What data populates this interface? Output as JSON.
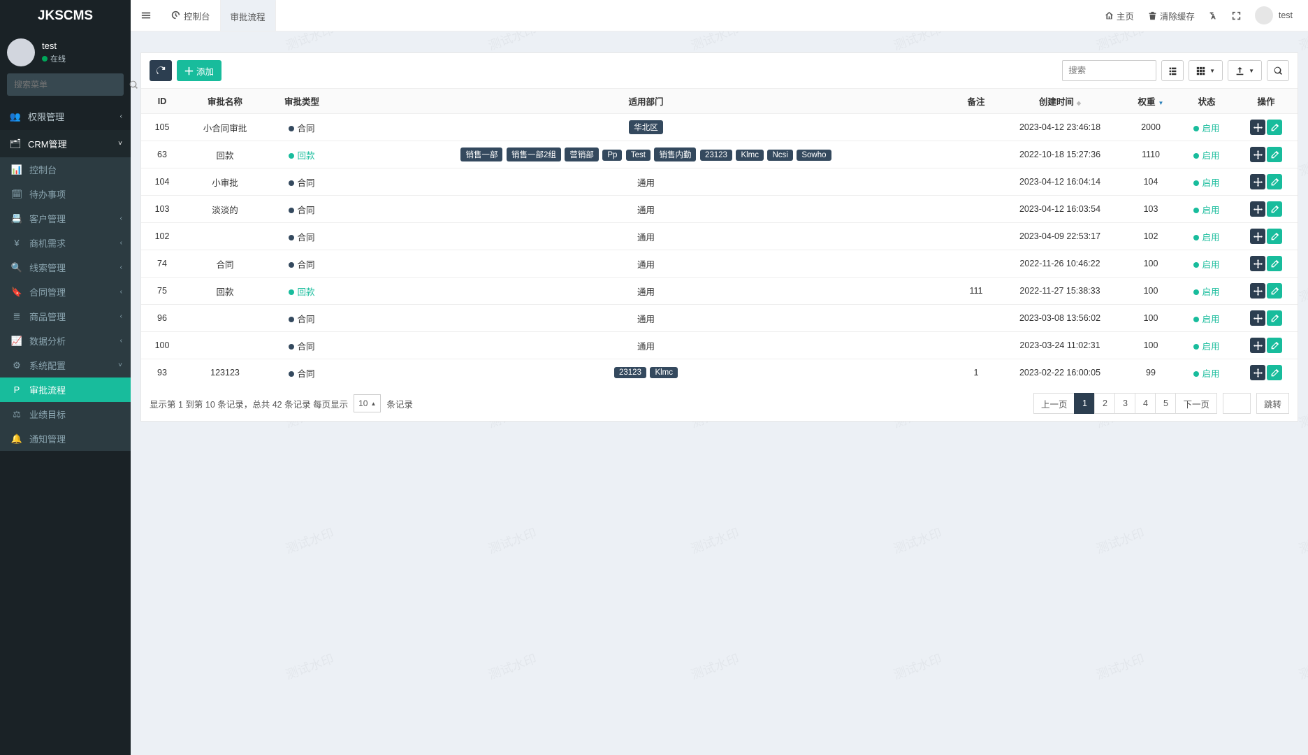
{
  "brand": "JKSCMS",
  "user": {
    "name": "test",
    "status": "在线"
  },
  "search_placeholder": "搜索菜单",
  "topbar": {
    "tabs": [
      {
        "icon": "dashboard-icon",
        "label": "控制台"
      },
      {
        "icon": "",
        "label": "审批流程",
        "active": true
      }
    ],
    "home": "主页",
    "clear_cache": "清除缓存",
    "username": "test"
  },
  "sidebar": {
    "items": [
      {
        "icon": "👥",
        "label": "权限管理",
        "has_children": true
      },
      {
        "icon": "🗂",
        "label": "CRM管理",
        "has_children": true,
        "open": true,
        "children": [
          {
            "icon": "📊",
            "label": "控制台"
          },
          {
            "icon": "🗓",
            "label": "待办事项"
          },
          {
            "icon": "📇",
            "label": "客户管理",
            "has_children": true
          },
          {
            "icon": "¥",
            "label": "商机需求",
            "has_children": true
          },
          {
            "icon": "🔍",
            "label": "线索管理",
            "has_children": true
          },
          {
            "icon": "🔖",
            "label": "合同管理",
            "has_children": true
          },
          {
            "icon": "≣",
            "label": "商品管理",
            "has_children": true
          },
          {
            "icon": "📈",
            "label": "数据分析",
            "has_children": true
          },
          {
            "icon": "⚙",
            "label": "系统配置",
            "has_children": true,
            "open": true,
            "children": [
              {
                "icon": "P",
                "label": "审批流程",
                "active": true
              },
              {
                "icon": "⚖",
                "label": "业绩目标"
              },
              {
                "icon": "🔔",
                "label": "通知管理"
              }
            ]
          }
        ]
      }
    ]
  },
  "toolbar": {
    "add_label": "添加",
    "search_placeholder": "搜索"
  },
  "columns": [
    "ID",
    "审批名称",
    "审批类型",
    "适用部门",
    "备注",
    "创建时间",
    "权重",
    "状态",
    "操作"
  ],
  "status_label": "启用",
  "type_labels": {
    "contract": "合同",
    "payment": "回款"
  },
  "rows": [
    {
      "id": "105",
      "name": "小合同审批",
      "type": "contract",
      "dept": [
        "华北区"
      ],
      "remark": "",
      "created": "2023-04-12 23:46:18",
      "weight": "2000"
    },
    {
      "id": "63",
      "name": "回款",
      "type": "payment",
      "dept": [
        "销售一部",
        "销售一部2组",
        "营销部",
        "Pp",
        "Test",
        "销售内勤",
        "23123",
        "Klmc",
        "Ncsi",
        "Sowho"
      ],
      "remark": "",
      "created": "2022-10-18 15:27:36",
      "weight": "1110"
    },
    {
      "id": "104",
      "name": "小审批",
      "type": "contract",
      "dept": "通用",
      "remark": "",
      "created": "2023-04-12 16:04:14",
      "weight": "104"
    },
    {
      "id": "103",
      "name": "淡淡的",
      "type": "contract",
      "dept": "通用",
      "remark": "",
      "created": "2023-04-12 16:03:54",
      "weight": "103"
    },
    {
      "id": "102",
      "name": "",
      "type": "contract",
      "dept": "通用",
      "remark": "",
      "created": "2023-04-09 22:53:17",
      "weight": "102"
    },
    {
      "id": "74",
      "name": "合同",
      "type": "contract",
      "dept": "通用",
      "remark": "",
      "created": "2022-11-26 10:46:22",
      "weight": "100"
    },
    {
      "id": "75",
      "name": "回款",
      "type": "payment",
      "dept": "通用",
      "remark": "111",
      "created": "2022-11-27 15:38:33",
      "weight": "100"
    },
    {
      "id": "96",
      "name": "",
      "type": "contract",
      "dept": "通用",
      "remark": "",
      "created": "2023-03-08 13:56:02",
      "weight": "100"
    },
    {
      "id": "100",
      "name": "",
      "type": "contract",
      "dept": "通用",
      "remark": "",
      "created": "2023-03-24 11:02:31",
      "weight": "100"
    },
    {
      "id": "93",
      "name": "123123",
      "type": "contract",
      "dept": [
        "23123",
        "Klmc"
      ],
      "remark": "1",
      "created": "2023-02-22 16:00:05",
      "weight": "99"
    }
  ],
  "footer": {
    "info_prefix": "显示第 1 到第 10 条记录，总共 42 条记录 每页显示",
    "per_page": "10",
    "info_suffix": "条记录",
    "prev": "上一页",
    "next": "下一页",
    "pages": [
      "1",
      "2",
      "3",
      "4",
      "5"
    ],
    "jump": "跳转"
  },
  "watermark_text": "测试水印"
}
